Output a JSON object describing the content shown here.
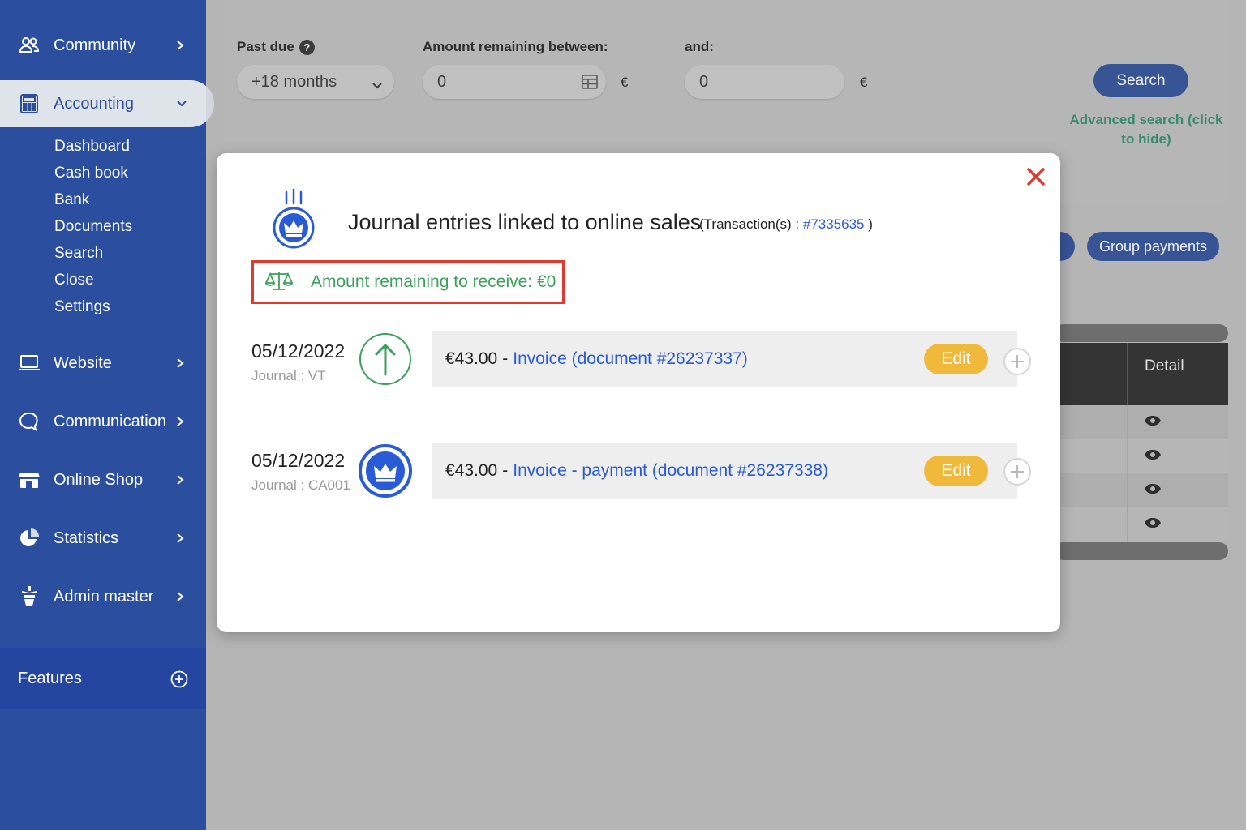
{
  "sidebar": {
    "items": [
      {
        "label": "Community"
      },
      {
        "label": "Accounting"
      },
      {
        "label": "Website"
      },
      {
        "label": "Communication"
      },
      {
        "label": "Online Shop"
      },
      {
        "label": "Statistics"
      },
      {
        "label": "Admin master"
      }
    ],
    "subitems": [
      "Dashboard",
      "Cash book",
      "Bank",
      "Documents",
      "Search",
      "Close",
      "Settings"
    ],
    "features_label": "Features"
  },
  "filters": {
    "past_due_label": "Past due",
    "past_due_value": "+18 months",
    "amount_between_label": "Amount remaining between:",
    "amount_min": "0",
    "and_label": "and:",
    "amount_max": "0",
    "currency": "€",
    "search_button": "Search",
    "advanced_search_link": "Advanced search (click to hide)"
  },
  "background": {
    "group_payments_button": "Group payments",
    "table_header_detail": "Detail"
  },
  "modal": {
    "title": "Journal entries linked to online sales",
    "transactions_prefix": "(Transaction(s) :",
    "transaction_id": "#7335635",
    "transactions_suffix": ")",
    "amount_remaining": "Amount remaining to receive: €0",
    "entries": [
      {
        "date": "05/12/2022",
        "journal": "Journal : VT",
        "amount": "€43.00",
        "separator": "-",
        "document": "Invoice (document #26237337)",
        "edit_label": "Edit"
      },
      {
        "date": "05/12/2022",
        "journal": "Journal : CA001",
        "amount": "€43.00",
        "separator": "-",
        "document": "Invoice - payment (document #26237338)",
        "edit_label": "Edit"
      }
    ]
  },
  "colors": {
    "sidebar": "#2b4f9e",
    "primary_button": "#2d4e98",
    "edit_button": "#f0b93b",
    "success_text": "#3aa05a",
    "link": "#2a5bd7",
    "highlight_border": "#e03a2f",
    "close_icon": "#e03a2f"
  }
}
